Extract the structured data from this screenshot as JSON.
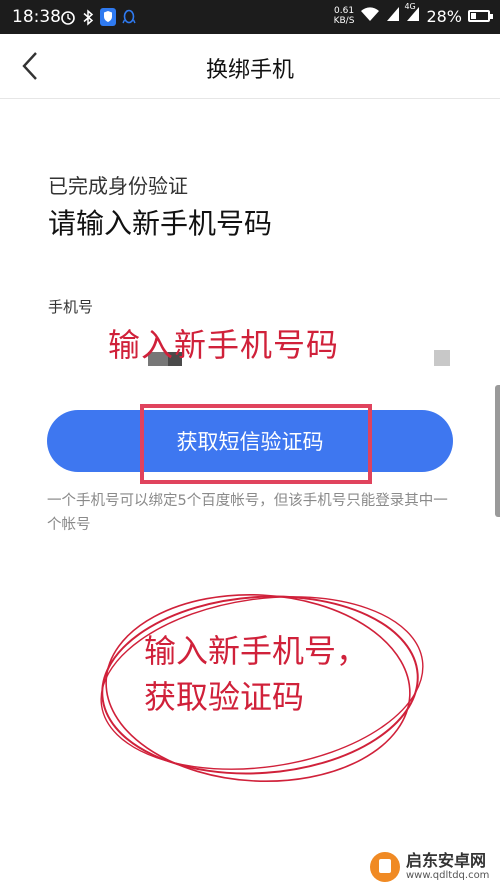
{
  "status_bar": {
    "time": "18:38",
    "net_speed_value": "0.61",
    "net_speed_unit": "KB/S",
    "network_type": "4G",
    "battery": "28%",
    "battery_level": 0.28,
    "icons": [
      "alarm-icon",
      "bluetooth-icon",
      "shield-icon",
      "qq-icon",
      "wifi-icon",
      "signal-icon",
      "signal-4g-icon",
      "battery-icon"
    ]
  },
  "header": {
    "back_icon": "chevron-left-icon",
    "title": "换绑手机"
  },
  "main": {
    "subtitle": "已完成身份验证",
    "title": "请输入新手机号码",
    "phone_label": "手机号",
    "phone_value": "",
    "sms_button_label": "获取短信验证码",
    "hint": "一个手机号可以绑定5个百度帐号，但该手机号只能登录其中一个帐号"
  },
  "annotations": {
    "input_note": "输入新手机号码",
    "circle_note_line1": "输入新手机号，",
    "circle_note_line2": "获取验证码",
    "color": "#d0213a"
  },
  "watermark": {
    "title": "启东安卓网",
    "url": "www.qdltdq.com"
  },
  "colors": {
    "primary_button": "#3e77f0",
    "status_bar_bg": "#1c1c1c",
    "highlight_box": "#e0435d"
  }
}
